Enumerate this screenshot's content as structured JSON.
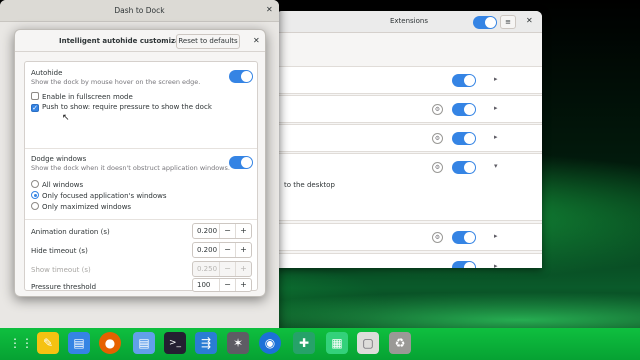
{
  "extensions_window": {
    "title": "Extensions",
    "menu_icon": "hamburger-icon",
    "close_icon": "close-icon",
    "description_fragment": "to the desktop",
    "rows": [
      {
        "enabled": true,
        "has_settings": false,
        "expanded": false
      },
      {
        "enabled": true,
        "has_settings": true,
        "expanded": false
      },
      {
        "enabled": true,
        "has_settings": true,
        "expanded": false
      },
      {
        "enabled": true,
        "has_settings": true,
        "expanded": true
      },
      {
        "enabled": true,
        "has_settings": true,
        "expanded": false
      },
      {
        "enabled": true,
        "has_settings": false,
        "expanded": false
      }
    ]
  },
  "dock_settings_window": {
    "title": "Dash to Dock",
    "close_icon": "close-icon"
  },
  "dialog": {
    "title": "Intelligent autohide customization",
    "reset_label": "Reset to defaults",
    "close_icon": "close-icon",
    "autohide": {
      "title": "Autohide",
      "subtitle": "Show the dock by mouse hover on the screen edge.",
      "enabled": true
    },
    "enable_fullscreen": {
      "label": "Enable in fullscreen mode",
      "checked": false
    },
    "push_to_show": {
      "label": "Push to show: require pressure to show the dock",
      "checked": true
    },
    "dodge_windows": {
      "title": "Dodge windows",
      "subtitle": "Show the dock when it doesn't obstruct application windows.",
      "enabled": true
    },
    "dodge_options": [
      {
        "label": "All windows",
        "selected": false
      },
      {
        "label": "Only focused application's windows",
        "selected": true
      },
      {
        "label": "Only maximized windows",
        "selected": false
      }
    ],
    "spinners": [
      {
        "label": "Animation duration (s)",
        "value": "0.200",
        "enabled": true
      },
      {
        "label": "Hide timeout (s)",
        "value": "0.200",
        "enabled": true
      },
      {
        "label": "Show timeout (s)",
        "value": "0.250",
        "enabled": false
      },
      {
        "label": "Pressure threshold",
        "value": "100",
        "enabled": true
      }
    ],
    "minus": "−",
    "plus": "+"
  },
  "dock_bar": {
    "items": [
      {
        "name": "apps-grid-icon",
        "glyph": "⋮⋮",
        "color": "#0fbf3f"
      },
      {
        "name": "notes-icon",
        "glyph": "✎",
        "color": "#f5c211"
      },
      {
        "name": "documents-icon",
        "glyph": "▤",
        "color": "#3584e4"
      },
      {
        "name": "firefox-icon",
        "glyph": "●",
        "color": "#e66100"
      },
      {
        "name": "text-editor-icon",
        "glyph": "▤",
        "color": "#62a0ea"
      },
      {
        "name": "terminal-icon",
        "glyph": ">_",
        "color": "#241f31"
      },
      {
        "name": "settings-tool-icon",
        "glyph": "⇶",
        "color": "#2a7dd4"
      },
      {
        "name": "gimp-icon",
        "glyph": "✶",
        "color": "#5e5c64"
      },
      {
        "name": "camera-icon",
        "glyph": "◉",
        "color": "#1c71d8"
      },
      {
        "name": "extensions-icon",
        "glyph": "✚",
        "color": "#26a269"
      },
      {
        "name": "screenshot-icon",
        "glyph": "▦",
        "color": "#33d17a"
      },
      {
        "name": "files-icon",
        "glyph": "▢",
        "color": "#deddda"
      },
      {
        "name": "trash-icon",
        "glyph": "♻",
        "color": "#9a9996"
      }
    ]
  }
}
